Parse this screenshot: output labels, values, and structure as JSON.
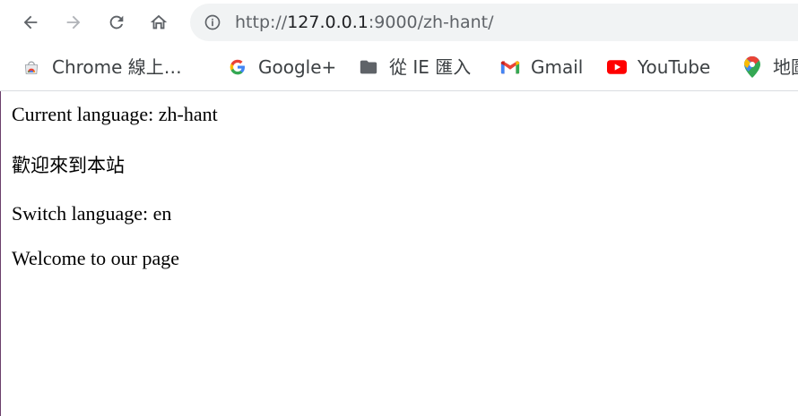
{
  "browser": {
    "nav": {
      "back_icon": "arrow-left-icon",
      "forward_icon": "arrow-right-icon",
      "reload_icon": "reload-icon",
      "home_icon": "home-icon"
    },
    "omnibox": {
      "info_icon": "info-icon",
      "url_scheme": "http://",
      "url_host": "127.0.0.1",
      "url_rest": ":9000/zh-hant/"
    },
    "bookmarks": [
      {
        "label": "Chrome 線上…",
        "icon": "chrome-web-store-icon"
      },
      {
        "label": "Google+",
        "icon": "google-g-icon"
      },
      {
        "label": "從 IE 匯入",
        "icon": "folder-icon"
      },
      {
        "label": "Gmail",
        "icon": "gmail-icon"
      },
      {
        "label": "YouTube",
        "icon": "youtube-icon"
      },
      {
        "label": "地圖",
        "icon": "maps-pin-icon"
      }
    ]
  },
  "page": {
    "current_language": "Current language: zh-hant",
    "welcome_zh": "歡迎來到本站",
    "switch_language": "Switch language: en",
    "welcome_en": "Welcome to our page"
  },
  "colors": {
    "toolbar_icon": "#5f6368",
    "omnibox_bg": "#f1f3f4",
    "youtube_red": "#ff0000",
    "folder_gray": "#5f6368"
  }
}
